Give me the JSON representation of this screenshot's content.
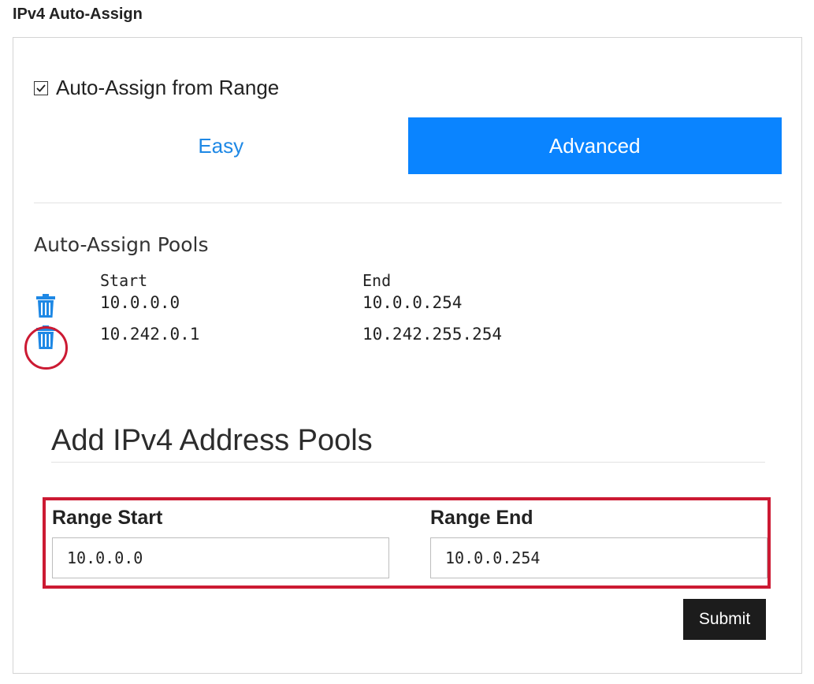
{
  "section_title": "IPv4 Auto-Assign",
  "auto_assign": {
    "checked": true,
    "label": "Auto-Assign from Range"
  },
  "tabs": [
    {
      "label": "Easy",
      "active": false
    },
    {
      "label": "Advanced",
      "active": true
    }
  ],
  "pools": {
    "heading": "Auto-Assign Pools",
    "columns": {
      "start": "Start",
      "end": "End"
    },
    "rows": [
      {
        "start": "10.0.0.0",
        "end": "10.0.0.254",
        "icon": "trash-icon"
      },
      {
        "start": "10.242.0.1",
        "end": "10.242.255.254",
        "icon": "trash-icon"
      }
    ]
  },
  "add_form": {
    "title": "Add IPv4 Address Pools",
    "range_start_label": "Range Start",
    "range_start_value": "10.0.0.0",
    "range_end_label": "Range End",
    "range_end_value": "10.0.0.254",
    "submit_label": "Submit"
  },
  "colors": {
    "accent": "#0a84ff",
    "easy_text": "#1e88e5",
    "highlight": "#cc1a33",
    "submit_bg": "#1c1c1c"
  }
}
